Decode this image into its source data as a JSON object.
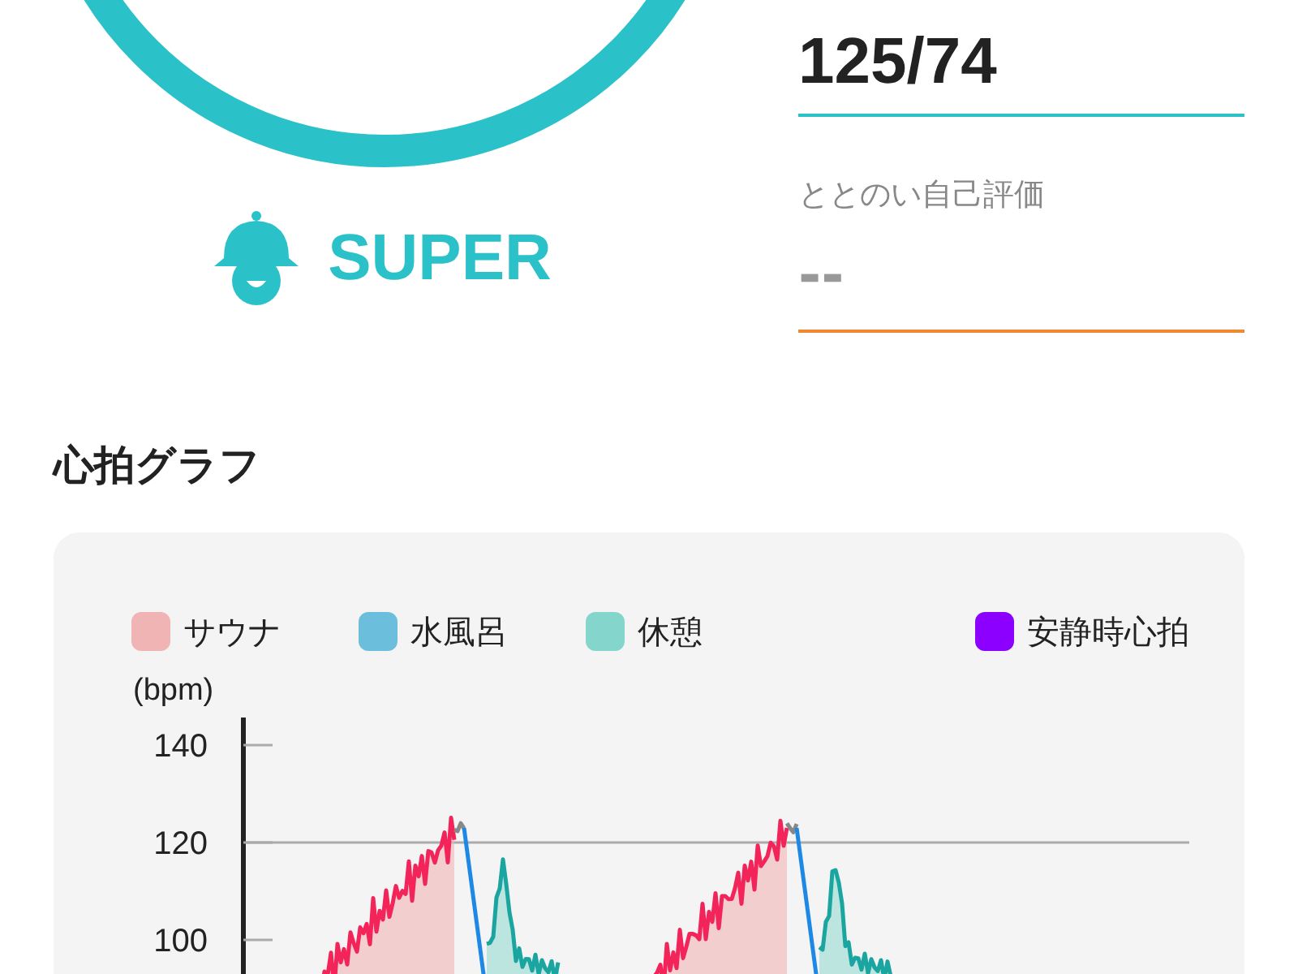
{
  "rank": {
    "label": "SUPER"
  },
  "blood_pressure": {
    "value": "125/74"
  },
  "self_rating": {
    "label": "ととのい自己評価",
    "value": "--"
  },
  "heart_graph": {
    "title": "心拍グラフ",
    "legend": [
      {
        "label": "サウナ",
        "color": "#f0b4b4"
      },
      {
        "label": "水風呂",
        "color": "#6bbfdc"
      },
      {
        "label": "休憩",
        "color": "#84d6cc"
      },
      {
        "label": "安静時心拍",
        "color": "#8b00ff"
      }
    ],
    "y_unit": "(bpm)",
    "y_ticks": [
      "140",
      "120",
      "100"
    ]
  }
}
